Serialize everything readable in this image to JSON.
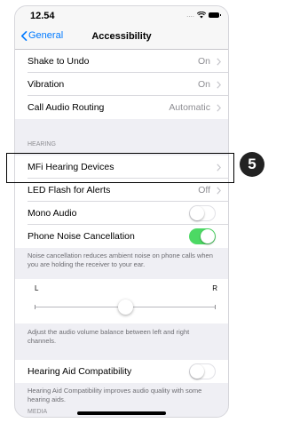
{
  "status_bar": {
    "time": "12.54",
    "signal": "....",
    "icons": [
      "wifi-icon",
      "battery-icon"
    ]
  },
  "nav": {
    "back_label": "General",
    "title": "Accessibility"
  },
  "rows_top": [
    {
      "label": "Shake to Undo",
      "value": "On"
    },
    {
      "label": "Vibration",
      "value": "On"
    },
    {
      "label": "Call Audio Routing",
      "value": "Automatic"
    }
  ],
  "hearing": {
    "header": "HEARING",
    "mfi_label": "MFi Hearing Devices",
    "led_label": "LED Flash for Alerts",
    "led_value": "Off",
    "mono_label": "Mono Audio",
    "mono_on": false,
    "noise_label": "Phone Noise Cancellation",
    "noise_on": true,
    "noise_footer": "Noise cancellation reduces ambient noise on phone calls when you are holding the receiver to your ear."
  },
  "balance": {
    "left_label": "L",
    "right_label": "R",
    "value": 0.5,
    "footer": "Adjust the audio volume balance between left and right channels."
  },
  "hac": {
    "label": "Hearing Aid Compatibility",
    "on": false,
    "footer": "Hearing Aid Compatibility improves audio quality with some hearing aids."
  },
  "media": {
    "header": "MEDIA"
  },
  "annotation": {
    "step": "5"
  },
  "colors": {
    "accent": "#007aff",
    "toggle_on": "#4cd964",
    "background": "#efeff4"
  }
}
